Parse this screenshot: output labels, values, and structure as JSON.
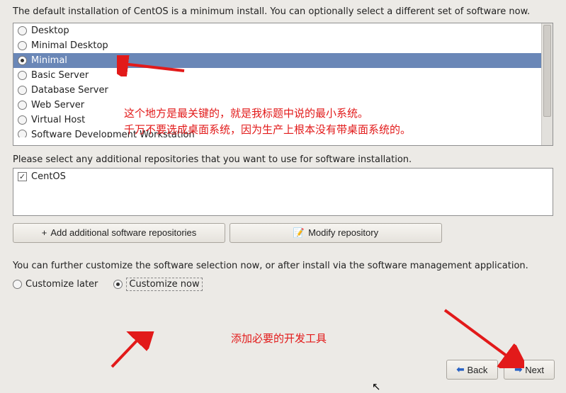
{
  "intro": "The default installation of CentOS is a minimum install. You can optionally select a different set of software now.",
  "software_options": [
    {
      "label": "Desktop",
      "selected": false
    },
    {
      "label": "Minimal Desktop",
      "selected": false
    },
    {
      "label": "Minimal",
      "selected": true
    },
    {
      "label": "Basic Server",
      "selected": false
    },
    {
      "label": "Database Server",
      "selected": false
    },
    {
      "label": "Web Server",
      "selected": false
    },
    {
      "label": "Virtual Host",
      "selected": false
    },
    {
      "label": "Software Development Workstation",
      "selected": false
    }
  ],
  "repo_label": "Please select any additional repositories that you want to use for software installation.",
  "repos": [
    {
      "label": "CentOS",
      "checked": true
    }
  ],
  "buttons": {
    "add_repo": "Add additional software repositories",
    "modify_repo": "Modify repository"
  },
  "customize_text": "You can further customize the software selection now, or after install via the software management application.",
  "customize": {
    "later": "Customize later",
    "now": "Customize now",
    "selected": "now"
  },
  "nav": {
    "back": "Back",
    "next": "Next"
  },
  "annotations": {
    "main_line1": "这个地方是最关键的，就是我标题中说的最小系统。",
    "main_line2": "千万不要选成桌面系统，因为生产上根本没有带桌面系统的。",
    "dev": "添加必要的开发工具"
  },
  "icons": {
    "plus": "+",
    "edit": "📝",
    "back": "⬅",
    "next": "➡",
    "check": "✓"
  }
}
